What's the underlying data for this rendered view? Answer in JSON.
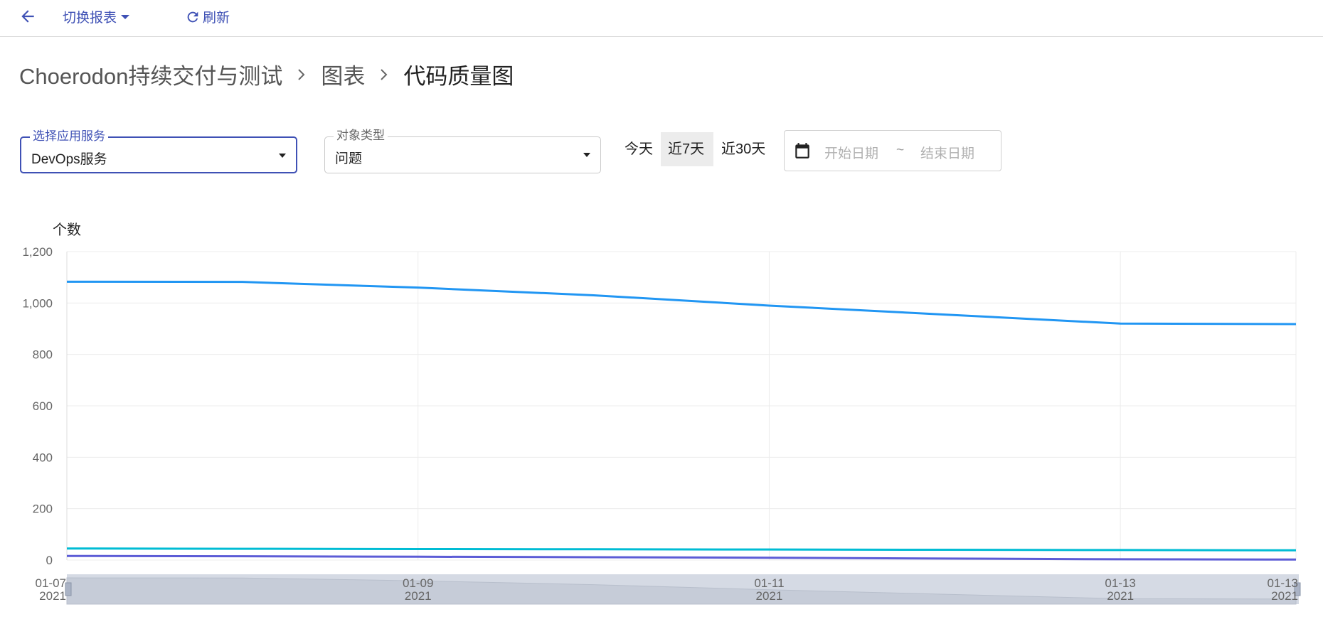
{
  "toolbar": {
    "back_icon": "arrow-left-icon",
    "switch_label": "切换报表",
    "refresh_label": "刷新",
    "accent": "#3f51b5"
  },
  "breadcrumb": {
    "project": "Choerodon持续交付与测试",
    "section": "图表",
    "current": "代码质量图"
  },
  "filters": {
    "service": {
      "label": "选择应用服务",
      "value": "DevOps服务"
    },
    "object_type": {
      "label": "对象类型",
      "value": "问题"
    },
    "ranges": [
      {
        "label": "今天",
        "active": false
      },
      {
        "label": "近7天",
        "active": true
      },
      {
        "label": "近30天",
        "active": false
      }
    ],
    "date_start_placeholder": "开始日期",
    "date_separator": "~",
    "date_end_placeholder": "结束日期"
  },
  "chart_data": {
    "type": "line",
    "ylabel": "个数",
    "ylim": [
      0,
      1200
    ],
    "yticks": [
      "0",
      "200",
      "400",
      "600",
      "800",
      "1,000",
      "1,200"
    ],
    "x": [
      "2021-01-07",
      "2021-01-08",
      "2021-01-09",
      "2021-01-10",
      "2021-01-11",
      "2021-01-12",
      "2021-01-13",
      "2021-01-14"
    ],
    "xtick_labels": [
      {
        "x": "2021-01-07",
        "top": "01-07",
        "bottom": "2021"
      },
      {
        "x": "2021-01-09",
        "top": "01-09",
        "bottom": "2021"
      },
      {
        "x": "2021-01-11",
        "top": "01-11",
        "bottom": "2021"
      },
      {
        "x": "2021-01-13",
        "top": "01-13",
        "bottom": "2021"
      },
      {
        "x": "2021-01-14",
        "top": "01-13",
        "bottom": "2021"
      }
    ],
    "series": [
      {
        "color": "#2196f3",
        "values": [
          1083,
          1082,
          1060,
          1030,
          990,
          955,
          920,
          918
        ]
      },
      {
        "color": "#00bcd4",
        "values": [
          45,
          44,
          43,
          42,
          41,
          40,
          39,
          38
        ]
      },
      {
        "color": "#5c5cd6",
        "values": [
          16,
          15,
          13,
          11,
          9,
          6,
          3,
          2
        ]
      }
    ],
    "grid": true,
    "legend": "none"
  }
}
